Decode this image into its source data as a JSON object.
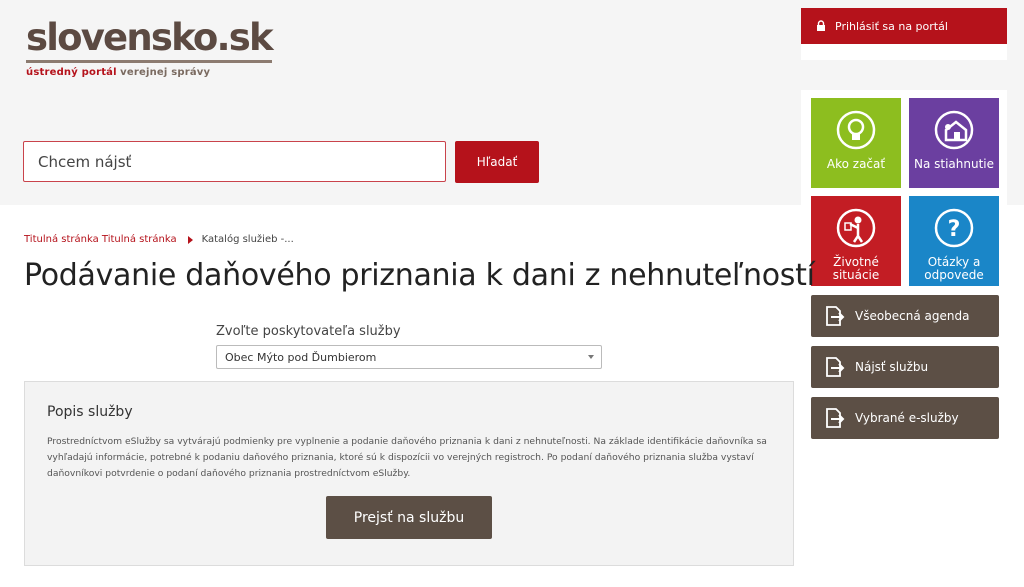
{
  "logo": {
    "name": "slovensko.sk",
    "subtitle_part1": "ústredný portál",
    "subtitle_part2": "verejnej správy"
  },
  "login": {
    "label": "Prihlásiť sa na portál"
  },
  "search": {
    "placeholder": "Chcem nájsť",
    "button_label": "Hľadať"
  },
  "tiles": [
    {
      "label": "Ako začať",
      "icon": "lightbulb-icon",
      "color": "#8dbe1f"
    },
    {
      "label": "Na stiahnutie",
      "icon": "download-house-icon",
      "color": "#6b3fa0"
    },
    {
      "label": "Životné situácie",
      "icon": "person-icon",
      "color": "#c31d24"
    },
    {
      "label": "Otázky a odpovede",
      "icon": "question-icon",
      "color": "#1a86c8"
    }
  ],
  "side_buttons": [
    {
      "label": "Všeobecná agenda",
      "icon": "document-arrow-icon"
    },
    {
      "label": "Nájsť službu",
      "icon": "document-arrow-icon"
    },
    {
      "label": "Vybrané e-služby",
      "icon": "document-arrow-icon"
    }
  ],
  "breadcrumb": {
    "home": "Titulná stránka Titulná stránka",
    "current": "Katalóg služieb -..."
  },
  "page_title": "Podávanie daňového priznania k dani z nehnuteľností",
  "provider": {
    "label": "Zvoľte poskytovateľa služby",
    "selected": "Obec Mýto pod Ďumbierom"
  },
  "description": {
    "title": "Popis služby",
    "text": "Prostredníctvom eSlužby sa vytvárajú podmienky pre vyplnenie a podanie daňového priznania k dani z nehnuteľnosti. Na základe identifikácie daňovníka sa vyhľadajú informácie, potrebné k podaniu daňového priznania, ktoré sú k dispozícii vo verejných registroch. Po podaní daňového priznania služba vystaví daňovníkovi potvrdenie o podaní daňového priznania prostredníctvom eSlužby.",
    "button_label": "Prejsť na službu"
  },
  "colors": {
    "brand_red": "#b5121b",
    "brand_brown": "#5c4f45"
  }
}
